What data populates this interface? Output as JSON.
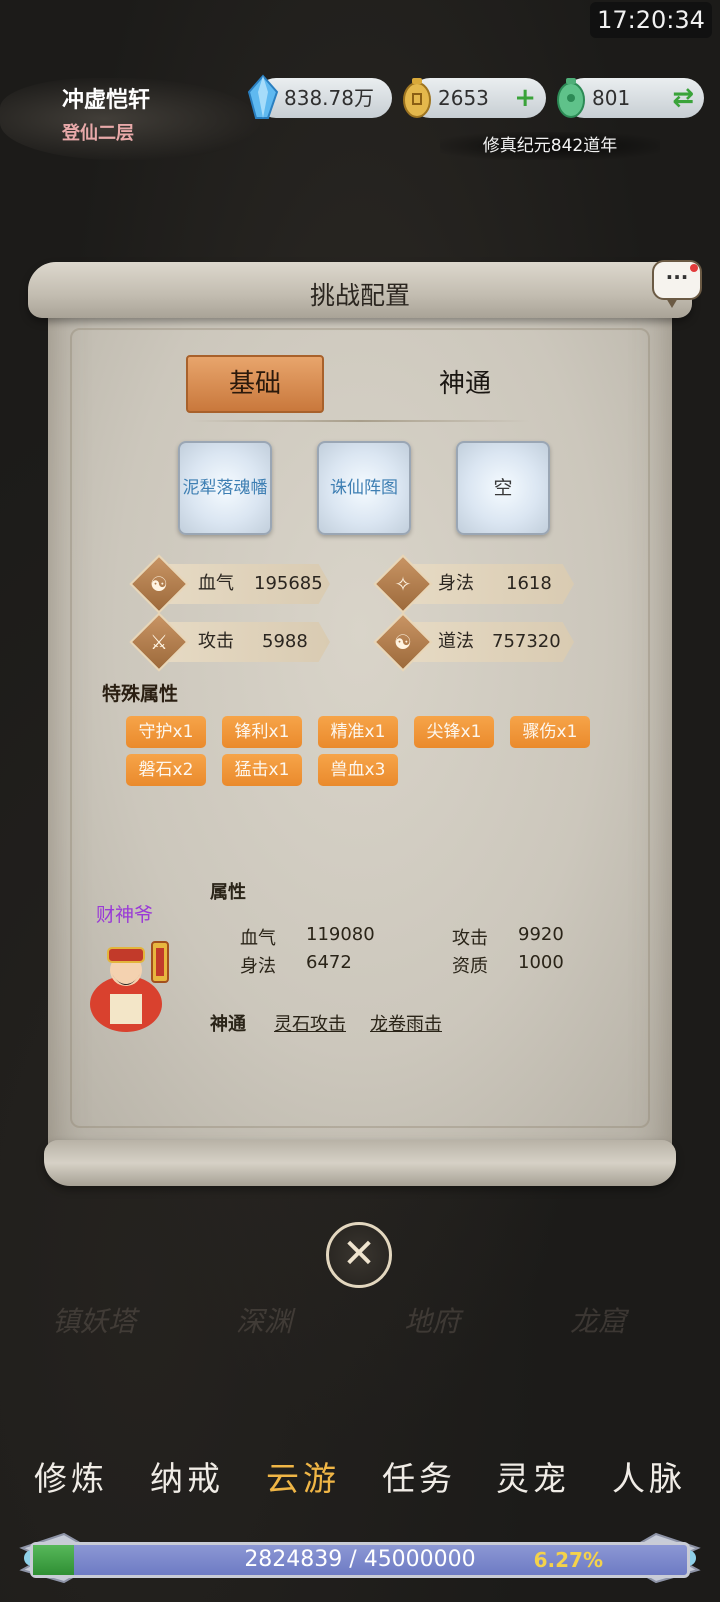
{
  "status": {
    "time": "17:20:34"
  },
  "player": {
    "name": "冲虚恺轩",
    "realm": "登仙二层"
  },
  "resources": [
    {
      "icon": "blue-crystal-icon",
      "value": "838.78万",
      "action": ""
    },
    {
      "icon": "gold-coin-icon",
      "value": "2653",
      "action": "+"
    },
    {
      "icon": "jade-icon",
      "value": "801",
      "action": "⇄"
    }
  ],
  "era": "修真纪元842道年",
  "panel": {
    "title": "挑战配置",
    "tabs": [
      "基础",
      "神通"
    ],
    "active_tab": "基础",
    "slots": [
      "泥犁落魂幡",
      "诛仙阵图",
      "空"
    ],
    "stats": [
      {
        "icon": "meditation-icon",
        "label": "血气",
        "value": "195685"
      },
      {
        "icon": "running-icon",
        "label": "身法",
        "value": "1618"
      },
      {
        "icon": "crossed-swords-icon",
        "label": "攻击",
        "value": "5988"
      },
      {
        "icon": "yin-yang-icon",
        "label": "道法",
        "value": "757320"
      }
    ],
    "special_title": "特殊属性",
    "special_attrs": [
      "守护x1",
      "锋利x1",
      "精准x1",
      "尖锋x1",
      "骤伤x1",
      "磐石x2",
      "猛击x1",
      "兽血x3"
    ]
  },
  "boss": {
    "name": "财神爷",
    "attr_heading": "属性",
    "attrs": [
      {
        "label": "血气",
        "value": "119080"
      },
      {
        "label": "攻击",
        "value": "9920"
      },
      {
        "label": "身法",
        "value": "6472"
      },
      {
        "label": "资质",
        "value": "1000"
      }
    ],
    "skill_heading": "神通",
    "skills": [
      "灵石攻击",
      "龙卷雨击"
    ]
  },
  "ghost_nav": [
    "镇妖塔",
    "深渊",
    "地府",
    "龙窟"
  ],
  "nav": [
    "修炼",
    "纳戒",
    "云游",
    "任务",
    "灵宠",
    "人脉"
  ],
  "nav_active": "云游",
  "exp": {
    "text": "2824839 / 45000000",
    "percent_label": "6.27%",
    "fraction": 0.0627
  },
  "colors": {
    "accent_orange": "#ea8a2c",
    "active_nav": "#f0b646",
    "boss_name": "#9a3bd6"
  }
}
